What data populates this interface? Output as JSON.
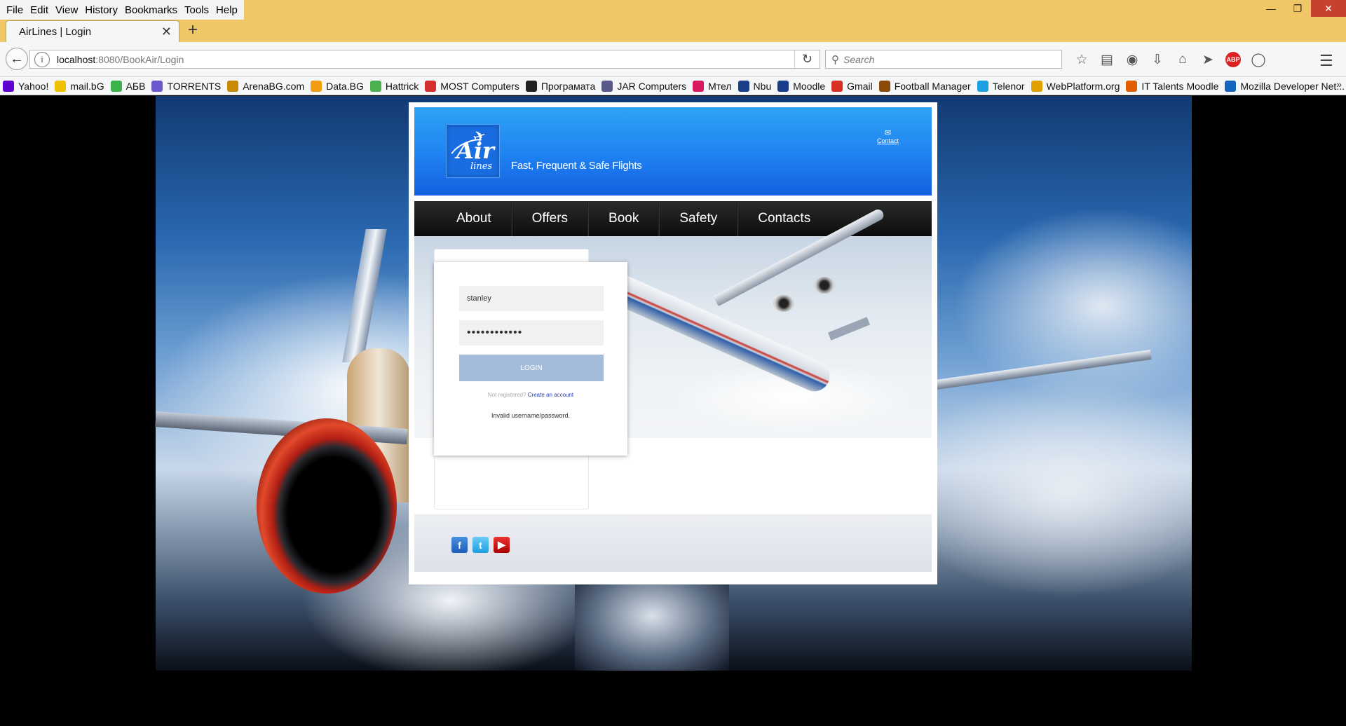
{
  "browser": {
    "menu": [
      "File",
      "Edit",
      "View",
      "History",
      "Bookmarks",
      "Tools",
      "Help"
    ],
    "tab_title": "AirLines | Login",
    "url_host": "localhost",
    "url_rest": ":8080/BookAir/Login",
    "search_placeholder": "Search",
    "bookmarks": [
      {
        "label": "Yahoo!",
        "color": "#5f01d1"
      },
      {
        "label": "mail.bG",
        "color": "#f0c000"
      },
      {
        "label": "АБВ",
        "color": "#3bb24a"
      },
      {
        "label": "TORRENTS",
        "color": "#6a5acd"
      },
      {
        "label": "ArenaBG.com",
        "color": "#c78a00"
      },
      {
        "label": "Data.BG",
        "color": "#f39c12"
      },
      {
        "label": "Hattrick",
        "color": "#4caf50"
      },
      {
        "label": "MOST Computers",
        "color": "#d32f2f"
      },
      {
        "label": "Програмата",
        "color": "#222222"
      },
      {
        "label": "JAR Computers",
        "color": "#5a5a8a"
      },
      {
        "label": "Мтел",
        "color": "#d81b60"
      },
      {
        "label": "Nbu",
        "color": "#1a3e8a"
      },
      {
        "label": "Moodle",
        "color": "#1a3e8a"
      },
      {
        "label": "Gmail",
        "color": "#d93025"
      },
      {
        "label": "Football Manager",
        "color": "#8a4b08"
      },
      {
        "label": "Telenor",
        "color": "#1ca0e3"
      },
      {
        "label": "WebPlatform.org",
        "color": "#e0a000"
      },
      {
        "label": "IT Talents Moodle",
        "color": "#e06000"
      },
      {
        "label": "Mozilla Developer Net...",
        "color": "#1565c0"
      }
    ]
  },
  "site": {
    "tagline": "Fast, Frequent & Safe Flights",
    "logo_main": "Air",
    "logo_sub": "lines",
    "contact_link": "Contact",
    "nav": [
      "About",
      "Offers",
      "Book",
      "Safety",
      "Contacts"
    ],
    "login": {
      "username": "stanley",
      "password_mask": "••••••••••••",
      "button": "Login",
      "not_registered": "Not registered?",
      "create_account": "Create an account",
      "error": "Invalid username/password."
    },
    "social": [
      "facebook",
      "twitter",
      "youtube"
    ]
  }
}
